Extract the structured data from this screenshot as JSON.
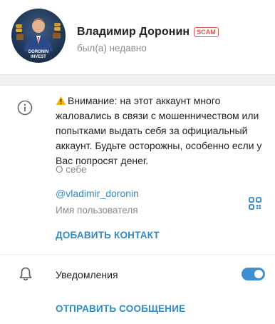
{
  "profile": {
    "name": "Владимир Доронин",
    "badge": "SCAM",
    "status": "был(а) недавно",
    "avatar_text_line1": "DORONIN",
    "avatar_text_line2": "INVEST"
  },
  "about": {
    "warning_text": "Внимание: на этот аккаунт много жаловались в связи с мошенничеством или попытками выдать себя за официальный аккаунт. Будьте осторожны, особенно если у Вас попросят денег.",
    "label": "О себе"
  },
  "username": {
    "value": "@vladimir_doronin",
    "label": "Имя пользователя"
  },
  "actions": {
    "add_contact": "ДОБАВИТЬ КОНТАКТ",
    "send_message": "ОТПРАВИТЬ СООБЩЕНИЕ"
  },
  "notifications": {
    "label": "Уведомления",
    "enabled": true
  },
  "icons": {
    "info": "info-icon",
    "warning": "warning-icon",
    "qr": "qr-code-icon",
    "bell": "bell-icon"
  },
  "colors": {
    "accent": "#2f8ac6",
    "scam": "#e0534f",
    "toggle_on": "#3d8fd1",
    "muted": "#8a8a8a"
  }
}
